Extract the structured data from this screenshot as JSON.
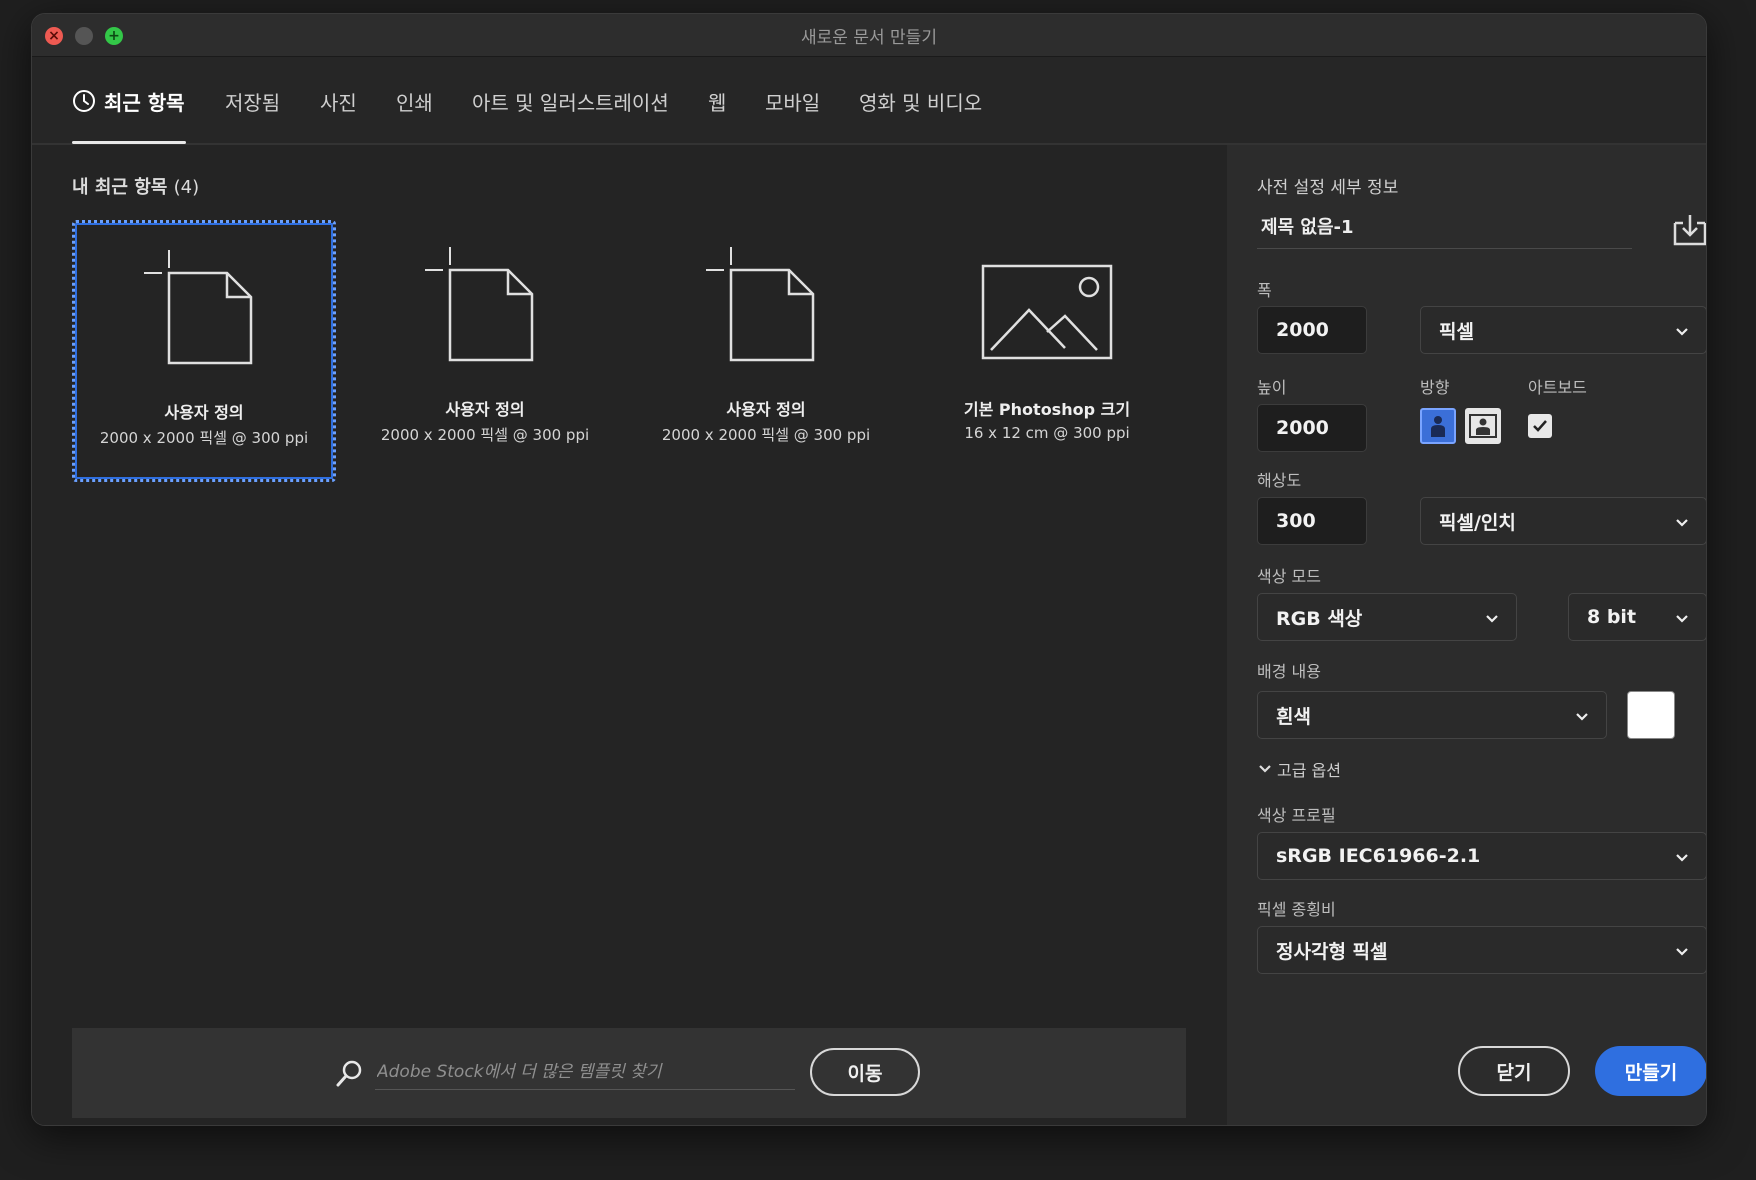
{
  "window": {
    "title": "새로운 문서 만들기"
  },
  "tabs": [
    {
      "label": "최근 항목",
      "active": true
    },
    {
      "label": "저장됨"
    },
    {
      "label": "사진"
    },
    {
      "label": "인쇄"
    },
    {
      "label": "아트 및 일러스트레이션"
    },
    {
      "label": "웹"
    },
    {
      "label": "모바일"
    },
    {
      "label": "영화 및 비디오"
    }
  ],
  "recent": {
    "title": "내 최근 항목",
    "count": "(4)",
    "items": [
      {
        "name": "사용자 정의",
        "desc": "2000 x 2000 픽셀 @ 300 ppi",
        "icon": "blank-document-icon",
        "selected": true
      },
      {
        "name": "사용자 정의",
        "desc": "2000 x 2000 픽셀 @ 300 ppi",
        "icon": "blank-document-icon"
      },
      {
        "name": "사용자 정의",
        "desc": "2000 x 2000 픽셀 @ 300 ppi",
        "icon": "blank-document-icon"
      },
      {
        "name": "기본 Photoshop 크기",
        "desc": "16 x 12 cm @ 300 ppi",
        "icon": "image-placeholder-icon"
      }
    ]
  },
  "stock": {
    "placeholder": "Adobe Stock에서 더 많은 템플릿 찾기",
    "go_label": "이동"
  },
  "preset": {
    "section_title": "사전 설정 세부 정보",
    "doc_name": "제목 없음-1",
    "width_label": "폭",
    "width_value": "2000",
    "width_unit": "픽셀",
    "height_label": "높이",
    "height_value": "2000",
    "orientation_label": "방향",
    "artboard_label": "아트보드",
    "artboard_checked": true,
    "resolution_label": "해상도",
    "resolution_value": "300",
    "resolution_unit": "픽셀/인치",
    "color_mode_label": "색상 모드",
    "color_mode_value": "RGB 색상",
    "bit_depth_value": "8 bit",
    "background_label": "배경 내용",
    "background_value": "흰색",
    "background_swatch": "#ffffff",
    "advanced_label": "고급 옵션",
    "color_profile_label": "색상 프로필",
    "color_profile_value": "sRGB IEC61966-2.1",
    "pixel_aspect_label": "픽셀 종횡비",
    "pixel_aspect_value": "정사각형 픽셀"
  },
  "actions": {
    "close_label": "닫기",
    "create_label": "만들기"
  },
  "colors": {
    "accent": "#2f6fe0",
    "close_light": "#ee5a52",
    "max_light": "#33c748"
  }
}
